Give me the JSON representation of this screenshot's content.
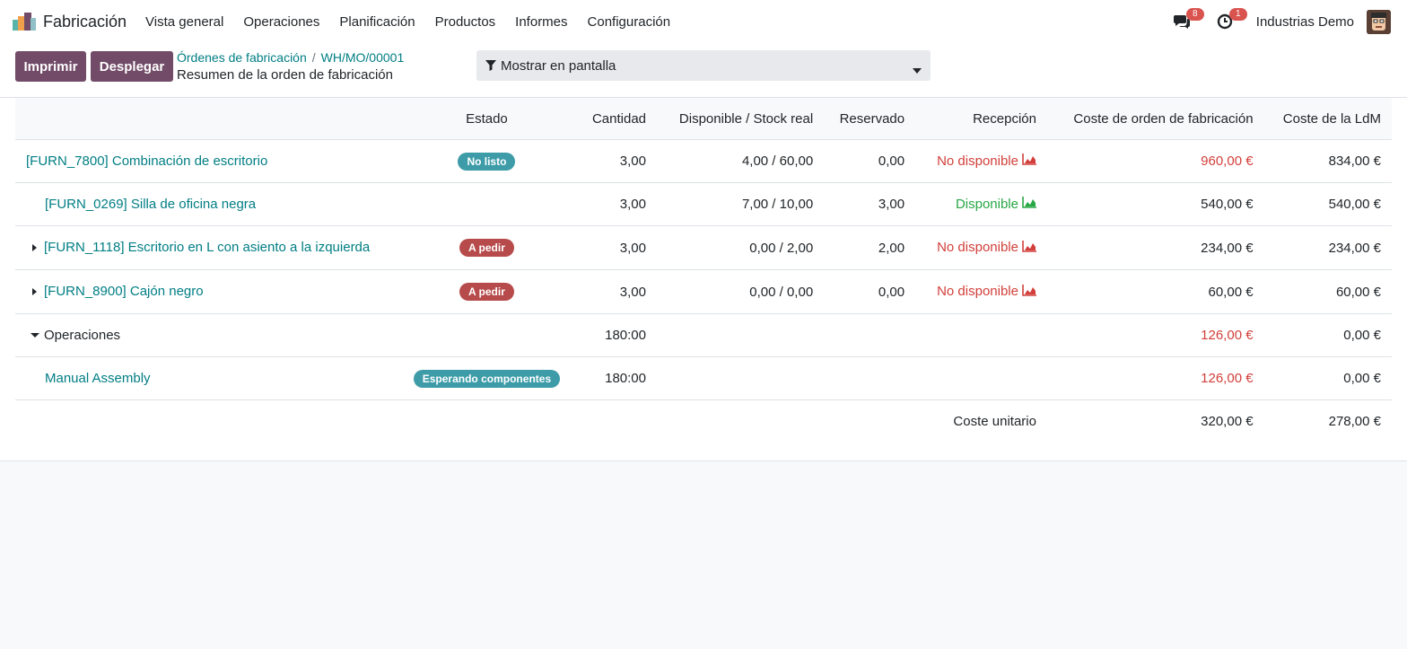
{
  "app": {
    "name": "Fabricación"
  },
  "menu": [
    "Vista general",
    "Operaciones",
    "Planificación",
    "Productos",
    "Informes",
    "Configuración"
  ],
  "nav_right": {
    "messages_count": "8",
    "activities_count": "1",
    "company": "Industrias Demo"
  },
  "toolbar": {
    "print_label": "Imprimir",
    "unfold_label": "Desplegar"
  },
  "breadcrumb": {
    "parent": "Órdenes de fabricación",
    "record": "WH/MO/00001"
  },
  "subtitle": "Resumen de la orden de fabricación",
  "filter": {
    "label": "Mostrar en pantalla"
  },
  "table": {
    "headers": {
      "state": "Estado",
      "quantity": "Cantidad",
      "available": "Disponible / Stock real",
      "reserved": "Reservado",
      "receipt": "Recepción",
      "mo_cost": "Coste de orden de fabricación",
      "bom_cost": "Coste de la LdM"
    },
    "rows": [
      {
        "name": "[FURN_7800] Combinación de escritorio",
        "state": "No listo",
        "quantity": "3,00",
        "available": "4,00 / 60,00",
        "reserved": "0,00",
        "receipt": "No disponible",
        "mo_cost": "960,00 €",
        "bom_cost": "834,00 €"
      },
      {
        "name": "[FURN_0269] Silla de oficina negra",
        "state": "",
        "quantity": "3,00",
        "available": "7,00 / 10,00",
        "reserved": "3,00",
        "receipt": "Disponible",
        "mo_cost": "540,00 €",
        "bom_cost": "540,00 €"
      },
      {
        "name": "[FURN_1118] Escritorio en L con asiento a la izquierda",
        "state": "A pedir",
        "quantity": "3,00",
        "available": "0,00 / 2,00",
        "reserved": "2,00",
        "receipt": "No disponible",
        "mo_cost": "234,00 €",
        "bom_cost": "234,00 €"
      },
      {
        "name": "[FURN_8900] Cajón negro",
        "state": "A pedir",
        "quantity": "3,00",
        "available": "0,00 / 0,00",
        "reserved": "0,00",
        "receipt": "No disponible",
        "mo_cost": "60,00 €",
        "bom_cost": "60,00 €"
      }
    ],
    "operations": {
      "label": "Operaciones",
      "quantity": "180:00",
      "mo_cost": "126,00 €",
      "bom_cost": "0,00 €"
    },
    "operation_rows": [
      {
        "name": "Manual Assembly",
        "state": "Esperando componentes",
        "quantity": "180:00",
        "mo_cost": "126,00 €",
        "bom_cost": "0,00 €"
      }
    ],
    "total": {
      "label": "Coste unitario",
      "mo_cost": "320,00 €",
      "bom_cost": "278,00 €"
    }
  },
  "colors": {
    "primary": "#714b67",
    "link": "#017e84",
    "danger": "#d23f3a",
    "success": "#28a745",
    "info_badge": "#3d9ca8",
    "danger_badge": "#b74b4b"
  },
  "icons": [
    "app-logo-icon",
    "chat-icon",
    "clock-icon",
    "avatar",
    "filter-icon",
    "caret-down-icon",
    "caret-right-icon",
    "area-chart-icon"
  ]
}
